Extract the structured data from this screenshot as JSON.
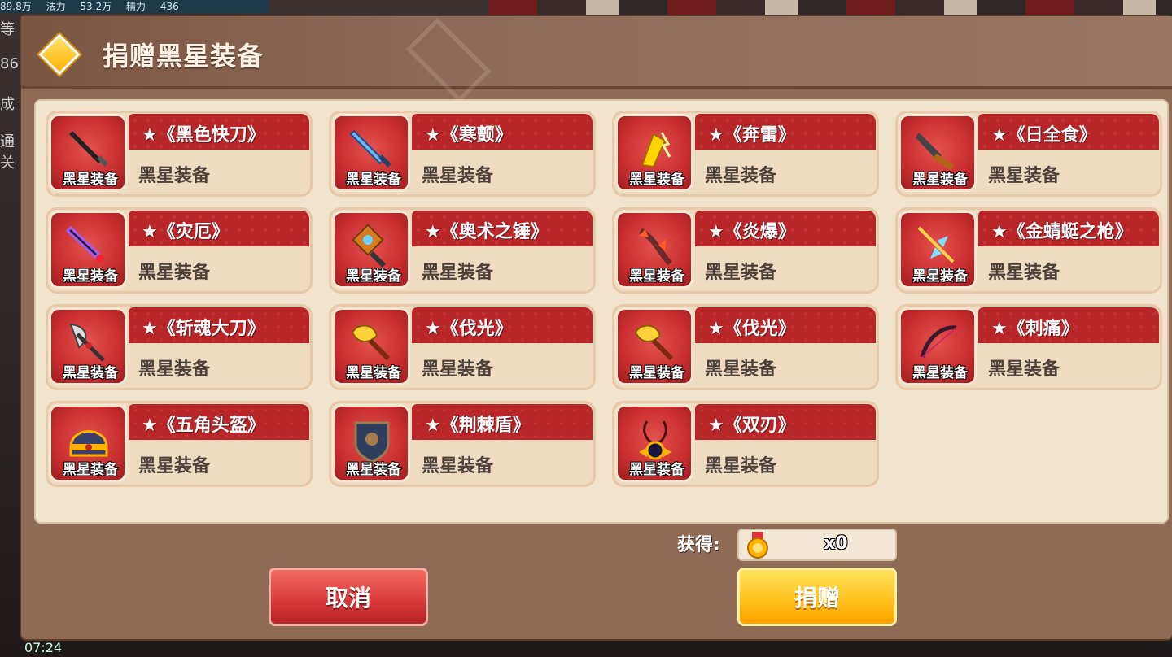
{
  "background": {
    "topbar": [
      "89.8万",
      "法力",
      "53.2万",
      "精力",
      "436"
    ],
    "left_text": [
      "等",
      "86",
      "成",
      "通关"
    ],
    "bottom_time": "07:24"
  },
  "dialog": {
    "title": "捐赠黑星装备",
    "items": [
      {
        "name": "★《黑色快刀》",
        "sub": "黑星装备",
        "badge": "黑星装备",
        "icon": "black-blade-icon"
      },
      {
        "name": "★《寒颤》",
        "sub": "黑星装备",
        "badge": "黑星装备",
        "icon": "ice-sword-icon"
      },
      {
        "name": "★《奔雷》",
        "sub": "黑星装备",
        "badge": "黑星装备",
        "icon": "thunder-glove-icon"
      },
      {
        "name": "★《日全食》",
        "sub": "黑星装备",
        "badge": "黑星装备",
        "icon": "eclipse-blade-icon"
      },
      {
        "name": "★《灾厄》",
        "sub": "黑星装备",
        "badge": "黑星装备",
        "icon": "calamity-sword-icon"
      },
      {
        "name": "★《奥术之锤》",
        "sub": "黑星装备",
        "badge": "黑星装备",
        "icon": "arcane-hammer-icon"
      },
      {
        "name": "★《炎爆》",
        "sub": "黑星装备",
        "badge": "黑星装备",
        "icon": "flame-blast-icon"
      },
      {
        "name": "★《金蜻蜓之枪》",
        "sub": "黑星装备",
        "badge": "黑星装备",
        "icon": "dragonfly-spear-icon"
      },
      {
        "name": "★《斩魂大刀》",
        "sub": "黑星装备",
        "badge": "黑星装备",
        "icon": "soul-axe-icon"
      },
      {
        "name": "★《伐光》",
        "sub": "黑星装备",
        "badge": "黑星装备",
        "icon": "light-axe-icon"
      },
      {
        "name": "★《伐光》",
        "sub": "黑星装备",
        "badge": "黑星装备",
        "icon": "light-axe-icon"
      },
      {
        "name": "★《刺痛》",
        "sub": "黑星装备",
        "badge": "黑星装备",
        "icon": "sting-bow-icon"
      },
      {
        "name": "★《五角头盔》",
        "sub": "黑星装备",
        "badge": "黑星装备",
        "icon": "pentagon-helmet-icon"
      },
      {
        "name": "★《荆棘盾》",
        "sub": "黑星装备",
        "badge": "黑星装备",
        "icon": "thorn-shield-icon"
      },
      {
        "name": "★《双刃》",
        "sub": "黑星装备",
        "badge": "黑星装备",
        "icon": "twin-blade-amulet-icon"
      }
    ],
    "obtain_label": "获得:",
    "obtain_count": "x0",
    "cancel_label": "取消",
    "donate_label": "捐赠"
  },
  "colors": {
    "card_red": "#b8262a",
    "panel_bg": "#f2e3cc",
    "header_brown": "#8d6a57",
    "cancel_red": "#d6383a",
    "donate_yellow": "#ffbf1a"
  }
}
